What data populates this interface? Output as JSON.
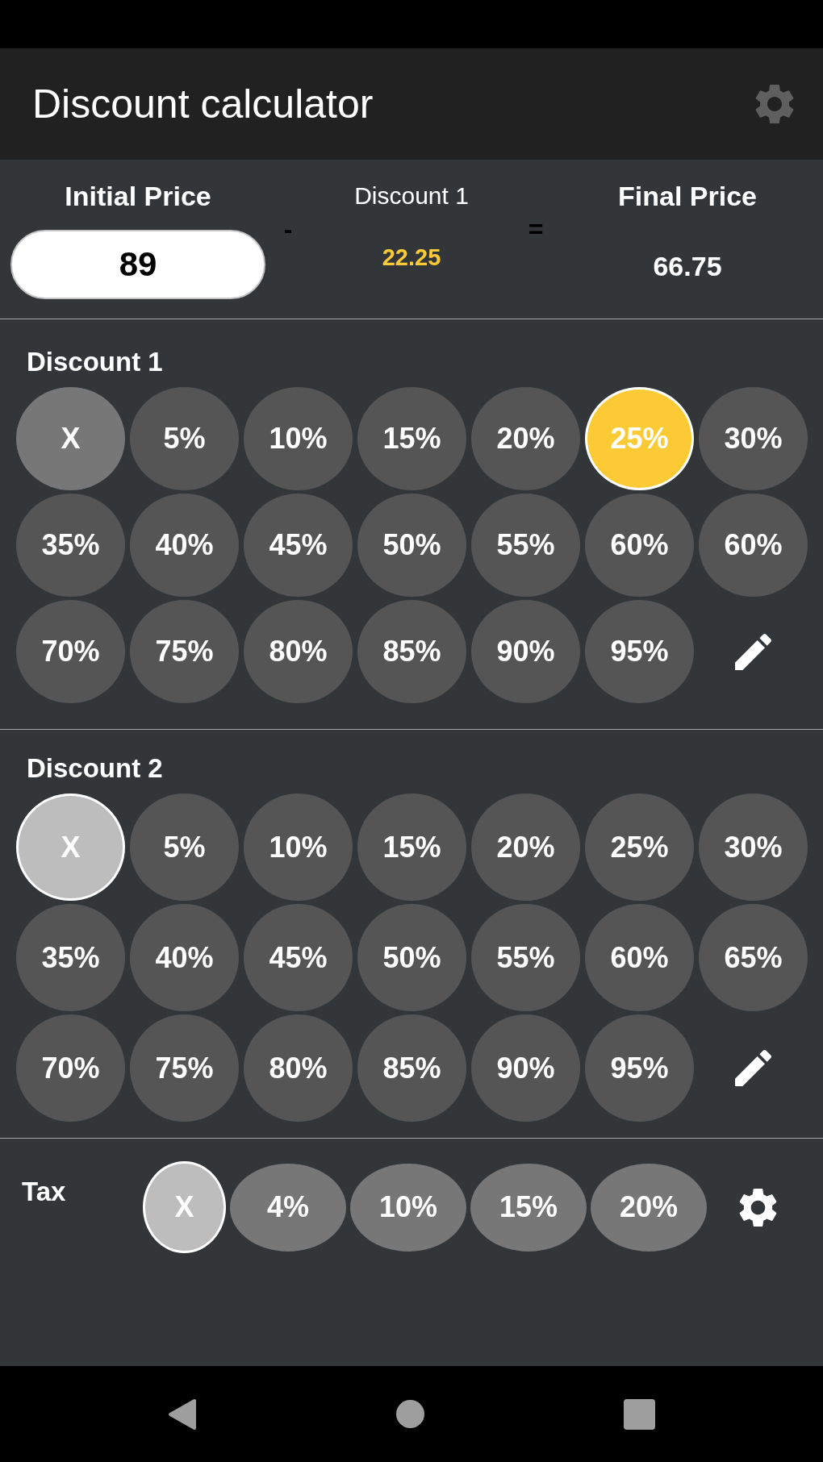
{
  "app_bar": {
    "title": "Discount calculator"
  },
  "summary": {
    "initial_price": {
      "label": "Initial Price",
      "value": "89"
    },
    "minus_sign": "-",
    "discount": {
      "label": "Discount 1",
      "amount": "22.25"
    },
    "equals_sign": "=",
    "final_price": {
      "label": "Final Price",
      "amount": "66.75"
    }
  },
  "discount_groups": [
    {
      "title": "Discount 1",
      "options": [
        {
          "label": "X",
          "kind": "clear",
          "selected": false
        },
        {
          "label": "5%",
          "kind": "percent",
          "selected": false
        },
        {
          "label": "10%",
          "kind": "percent",
          "selected": false
        },
        {
          "label": "15%",
          "kind": "percent",
          "selected": false
        },
        {
          "label": "20%",
          "kind": "percent",
          "selected": false
        },
        {
          "label": "25%",
          "kind": "percent",
          "selected": true
        },
        {
          "label": "30%",
          "kind": "percent",
          "selected": false
        },
        {
          "label": "35%",
          "kind": "percent",
          "selected": false
        },
        {
          "label": "40%",
          "kind": "percent",
          "selected": false
        },
        {
          "label": "45%",
          "kind": "percent",
          "selected": false
        },
        {
          "label": "50%",
          "kind": "percent",
          "selected": false
        },
        {
          "label": "55%",
          "kind": "percent",
          "selected": false
        },
        {
          "label": "60%",
          "kind": "percent",
          "selected": false
        },
        {
          "label": "60%",
          "kind": "percent",
          "selected": false
        },
        {
          "label": "70%",
          "kind": "percent",
          "selected": false
        },
        {
          "label": "75%",
          "kind": "percent",
          "selected": false
        },
        {
          "label": "80%",
          "kind": "percent",
          "selected": false
        },
        {
          "label": "85%",
          "kind": "percent",
          "selected": false
        },
        {
          "label": "90%",
          "kind": "percent",
          "selected": false
        },
        {
          "label": "95%",
          "kind": "percent",
          "selected": false
        }
      ]
    },
    {
      "title": "Discount 2",
      "options": [
        {
          "label": "X",
          "kind": "clear",
          "selected": true
        },
        {
          "label": "5%",
          "kind": "percent",
          "selected": false
        },
        {
          "label": "10%",
          "kind": "percent",
          "selected": false
        },
        {
          "label": "15%",
          "kind": "percent",
          "selected": false
        },
        {
          "label": "20%",
          "kind": "percent",
          "selected": false
        },
        {
          "label": "25%",
          "kind": "percent",
          "selected": false
        },
        {
          "label": "30%",
          "kind": "percent",
          "selected": false
        },
        {
          "label": "35%",
          "kind": "percent",
          "selected": false
        },
        {
          "label": "40%",
          "kind": "percent",
          "selected": false
        },
        {
          "label": "45%",
          "kind": "percent",
          "selected": false
        },
        {
          "label": "50%",
          "kind": "percent",
          "selected": false
        },
        {
          "label": "55%",
          "kind": "percent",
          "selected": false
        },
        {
          "label": "60%",
          "kind": "percent",
          "selected": false
        },
        {
          "label": "65%",
          "kind": "percent",
          "selected": false
        },
        {
          "label": "70%",
          "kind": "percent",
          "selected": false
        },
        {
          "label": "75%",
          "kind": "percent",
          "selected": false
        },
        {
          "label": "80%",
          "kind": "percent",
          "selected": false
        },
        {
          "label": "85%",
          "kind": "percent",
          "selected": false
        },
        {
          "label": "90%",
          "kind": "percent",
          "selected": false
        },
        {
          "label": "95%",
          "kind": "percent",
          "selected": false
        }
      ]
    }
  ],
  "tax": {
    "title": "Tax",
    "options": [
      {
        "label": "X",
        "kind": "clear",
        "selected": true
      },
      {
        "label": "4%",
        "kind": "percent",
        "selected": false
      },
      {
        "label": "10%",
        "kind": "percent",
        "selected": false
      },
      {
        "label": "15%",
        "kind": "percent",
        "selected": false
      },
      {
        "label": "20%",
        "kind": "percent",
        "selected": false
      }
    ]
  }
}
